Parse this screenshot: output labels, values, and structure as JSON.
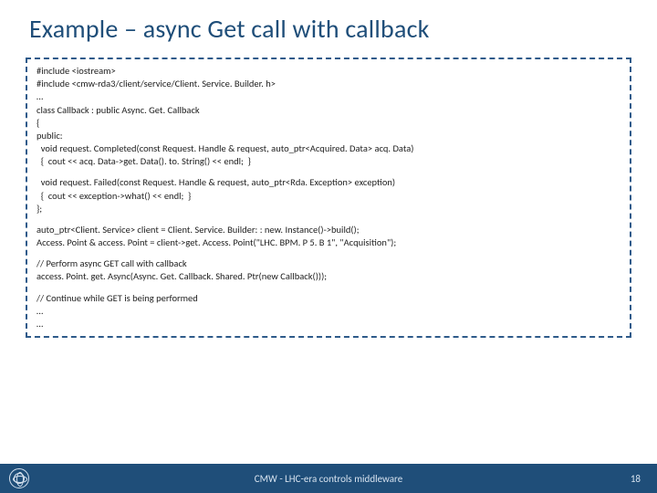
{
  "title": "Example – async Get call with callback",
  "code": {
    "b1": "#include <iostream>\n#include <cmw-rda3/client/service/Client. Service. Builder. h>\n…\nclass Callback : public Async. Get. Callback\n{\npublic:\n  void request. Completed(const Request. Handle & request, auto_ptr<Acquired. Data> acq. Data)\n  {  cout << acq. Data->get. Data(). to. String() << endl;  }",
    "b2": "  void request. Failed(const Request. Handle & request, auto_ptr<Rda. Exception> exception)\n  {  cout << exception->what() << endl;  }\n};",
    "b3": "auto_ptr<Client. Service> client = Client. Service. Builder: : new. Instance()->build();\nAccess. Point & access. Point = client->get. Access. Point(\"LHC. BPM. P 5. B 1\", \"Acquisition\");",
    "b4": "// Perform async GET call with callback\naccess. Point. get. Async(Async. Get. Callback. Shared. Ptr(new Callback()));",
    "b5": "// Continue while GET is being performed\n…\n…"
  },
  "footer": {
    "text": "CMW - LHC-era controls middleware",
    "page": "18"
  }
}
